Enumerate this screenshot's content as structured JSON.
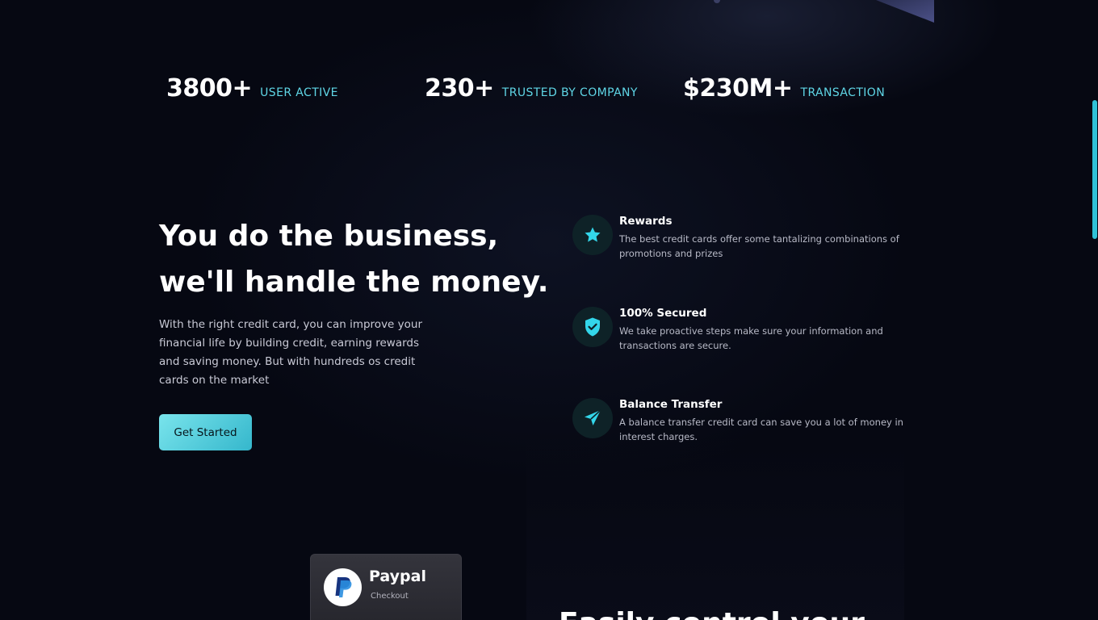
{
  "stats": [
    {
      "value": "3800+",
      "label": "USER ACTIVE"
    },
    {
      "value": "230+",
      "label": "TRUSTED BY COMPANY"
    },
    {
      "value": "$230M+",
      "label": "TRANSACTION"
    }
  ],
  "hero": {
    "title_line1": "You do the business,",
    "title_line2": "we'll handle the money.",
    "description": "With the right credit card, you can improve your financial life by building credit, earning rewards and saving money. But with hundreds os credit cards on the market",
    "cta_label": "Get Started"
  },
  "features": [
    {
      "icon": "star-icon",
      "title": "Rewards",
      "text": "The best credit cards offer some tantalizing combinations of promotions and prizes"
    },
    {
      "icon": "shield-check-icon",
      "title": "100% Secured",
      "text": "We take proactive steps make sure your information and transactions are secure."
    },
    {
      "icon": "send-icon",
      "title": "Balance Transfer",
      "text": "A balance transfer credit card can save you a lot of money in interest charges."
    }
  ],
  "paypal_card": {
    "name": "Paypal",
    "subtitle": "Checkout",
    "icon": "paypal-logo-icon"
  },
  "bottom_heading": "Easily control your",
  "colors": {
    "accent": "#5fd6e6",
    "background": "#060812",
    "cta_start": "#79e4ec",
    "cta_end": "#35b7cc"
  }
}
